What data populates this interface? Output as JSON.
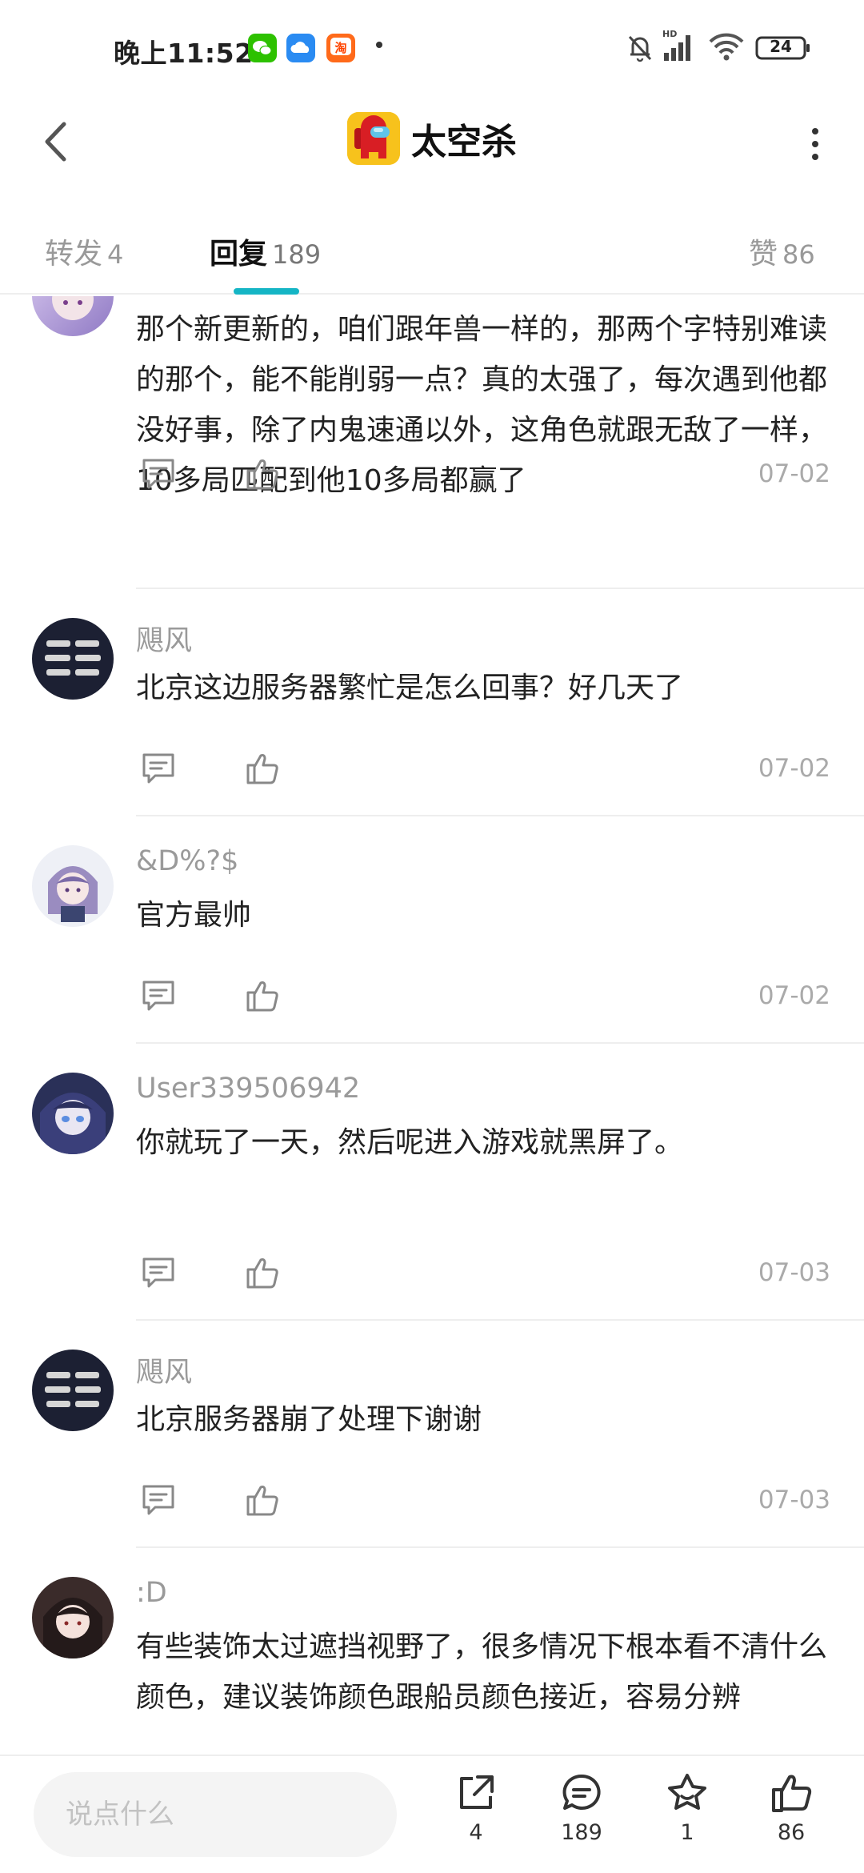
{
  "status_bar": {
    "time": "晚上11:52",
    "battery": "24",
    "network_label": "HD",
    "apps": [
      "wechat-icon",
      "cloud-icon",
      "taobao-icon"
    ]
  },
  "header": {
    "title": "太空杀",
    "back_icon": "chevron-left-icon",
    "more_icon": "more-vertical-icon"
  },
  "tabs": [
    {
      "label": "转发",
      "count": "4"
    },
    {
      "label": "回复",
      "count": "189"
    },
    {
      "label": "赞",
      "count": "86"
    }
  ],
  "active_tab": 1,
  "accent_color": "#15b5c5",
  "comments": [
    {
      "user": "",
      "text": "那个新更新的，咱们跟年兽一样的，那两个字特别难读的那个，能不能削弱一点？真的太强了，每次遇到他都没好事，除了内鬼速通以外，这角色就跟无敌了一样，10多局匹配到他10多局都赢了",
      "date": "07-02"
    },
    {
      "user": "飓风",
      "text": "北京这边服务器繁忙是怎么回事？好几天了",
      "date": "07-02"
    },
    {
      "user": "&D%?$",
      "text": "官方最帅",
      "date": "07-02"
    },
    {
      "user": "User339506942",
      "text": "你就玩了一天，然后呢进入游戏就黑屏了。",
      "date": "07-03"
    },
    {
      "user": "飓风",
      "text": "北京服务器崩了处理下谢谢",
      "date": "07-03"
    },
    {
      "user": ":D",
      "text": "有些装饰太过遮挡视野了，很多情况下根本看不清什么颜色，建议装饰颜色跟船员颜色接近，容易分辨",
      "date": ""
    }
  ],
  "bottom_bar": {
    "input_placeholder": "说点什么",
    "share_count": "4",
    "comment_count": "189",
    "star_count": "1",
    "like_count": "86"
  }
}
